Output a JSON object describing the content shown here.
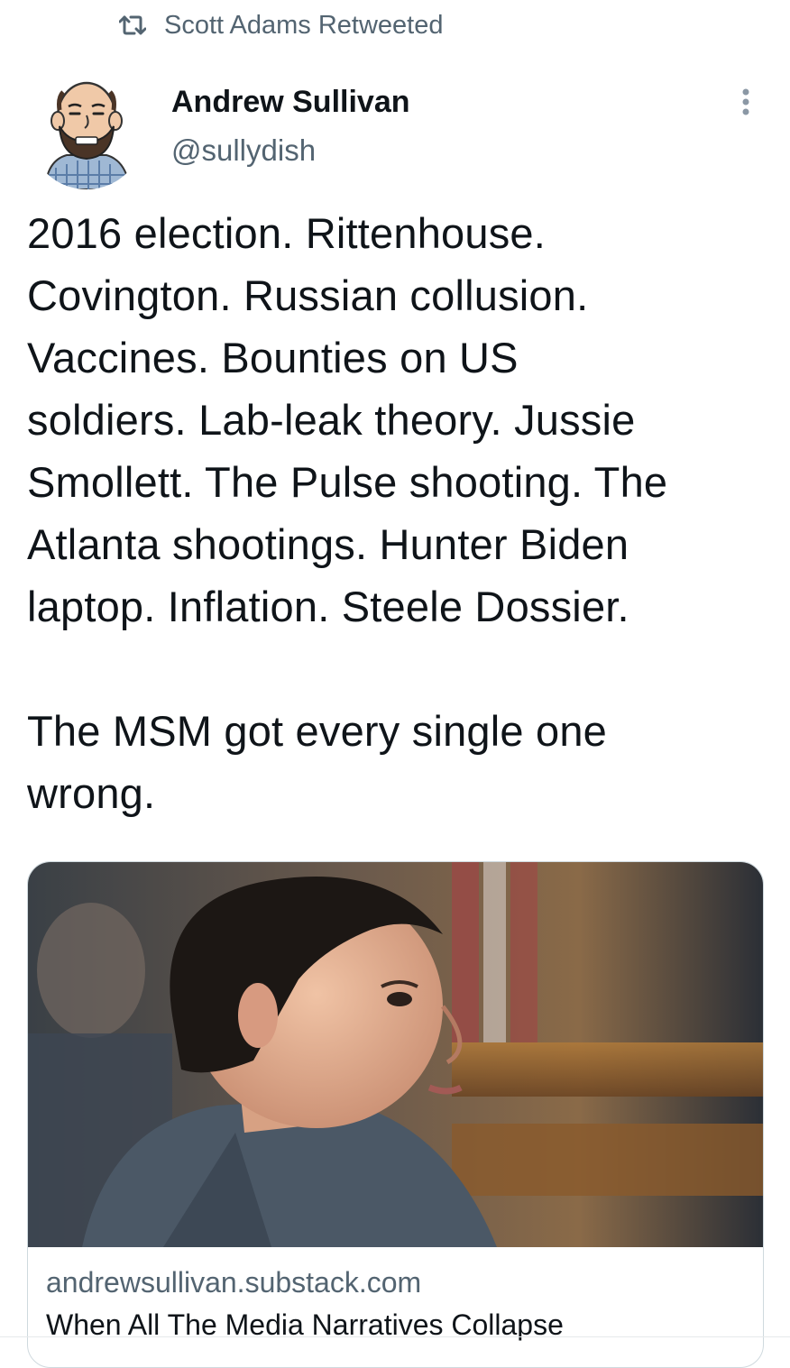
{
  "social_context": {
    "icon": "retweet-icon",
    "text": "Scott Adams Retweeted"
  },
  "author": {
    "name": "Andrew Sullivan",
    "handle": "@sullydish",
    "avatar_icon": "cartoon-avatar"
  },
  "more_icon": "more-vertical-icon",
  "tweet": {
    "text": "2016 election. Rittenhouse.\nCovington. Russian collusion.\nVaccines. Bounties on US\nsoldiers. Lab-leak theory. Jussie\nSmollett. The Pulse shooting. The\nAtlanta shootings. Hunter Biden\nlaptop. Inflation. Steele Dossier.\n\nThe MSM got every single one\nwrong."
  },
  "link_card": {
    "domain": "andrewsullivan.substack.com",
    "title": "When All The Media Narratives Collapse",
    "image": "courtroom-photo"
  },
  "colors": {
    "text_primary": "#0f1419",
    "text_secondary": "#536471",
    "border": "#cfd9de"
  }
}
